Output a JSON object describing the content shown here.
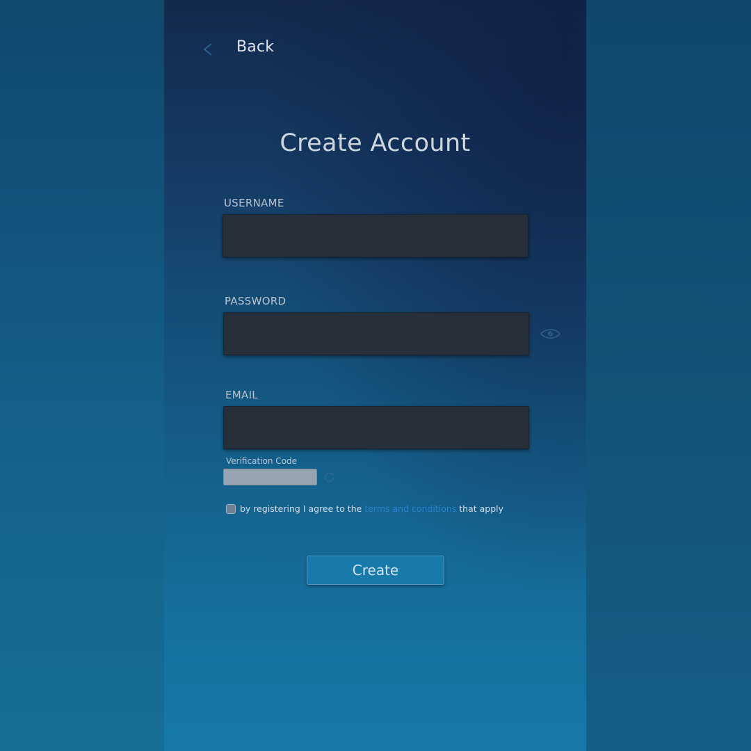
{
  "nav": {
    "back_label": "Back",
    "back_icon": "chevron-left-icon"
  },
  "page": {
    "title": "Create Account"
  },
  "form": {
    "username": {
      "label": "USERNAME",
      "value": "",
      "placeholder": ""
    },
    "password": {
      "label": "PASSWORD",
      "value": "",
      "placeholder": "",
      "toggle_icon": "eye-icon"
    },
    "email": {
      "label": "EMAIL",
      "value": "",
      "placeholder": ""
    },
    "verification": {
      "label": "Verification Code",
      "value": "",
      "refresh_icon": "refresh-icon"
    },
    "terms": {
      "prefix": "by registering I agree to the",
      "link": "terms and conditions",
      "suffix": "that apply",
      "checked": false
    },
    "submit_label": "Create"
  },
  "colors": {
    "panel_top": "#13294d",
    "panel_bottom": "#1679a8",
    "input_bg": "#272f3b",
    "button_bg": "#177aab",
    "link": "#2b82cc"
  }
}
